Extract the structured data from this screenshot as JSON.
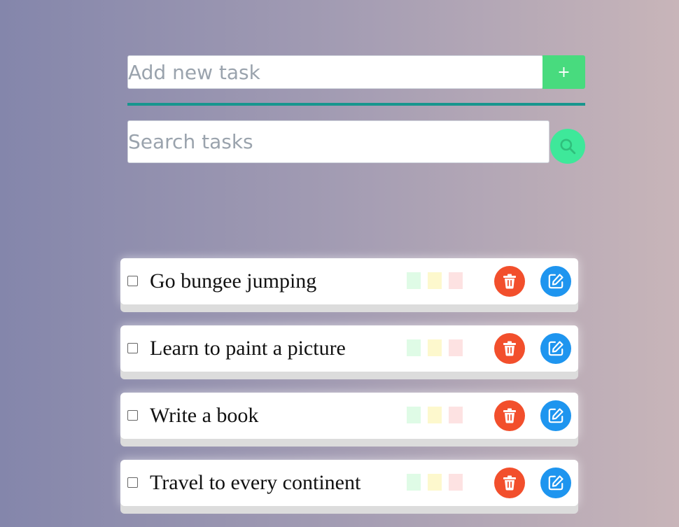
{
  "add_task": {
    "placeholder": "Add new task",
    "button_label": "+"
  },
  "search": {
    "placeholder": "Search tasks",
    "icon": "search-icon"
  },
  "tasks": [
    {
      "title": "Go bungee jumping",
      "checked": false
    },
    {
      "title": "Learn to paint a picture",
      "checked": false
    },
    {
      "title": "Write a book",
      "checked": false
    },
    {
      "title": "Travel to every continent",
      "checked": false
    }
  ],
  "priority_colors": {
    "low": "#dffbe6",
    "medium": "#fdf8cd",
    "high": "#fde2e2"
  },
  "icons": {
    "delete": "trash-icon",
    "edit": "edit-icon"
  },
  "colors": {
    "add_button": "#48db7e",
    "divider": "#17968e",
    "search_button": "#3ee89a",
    "delete_button": "#f24f2c",
    "edit_button": "#1e95ef"
  }
}
